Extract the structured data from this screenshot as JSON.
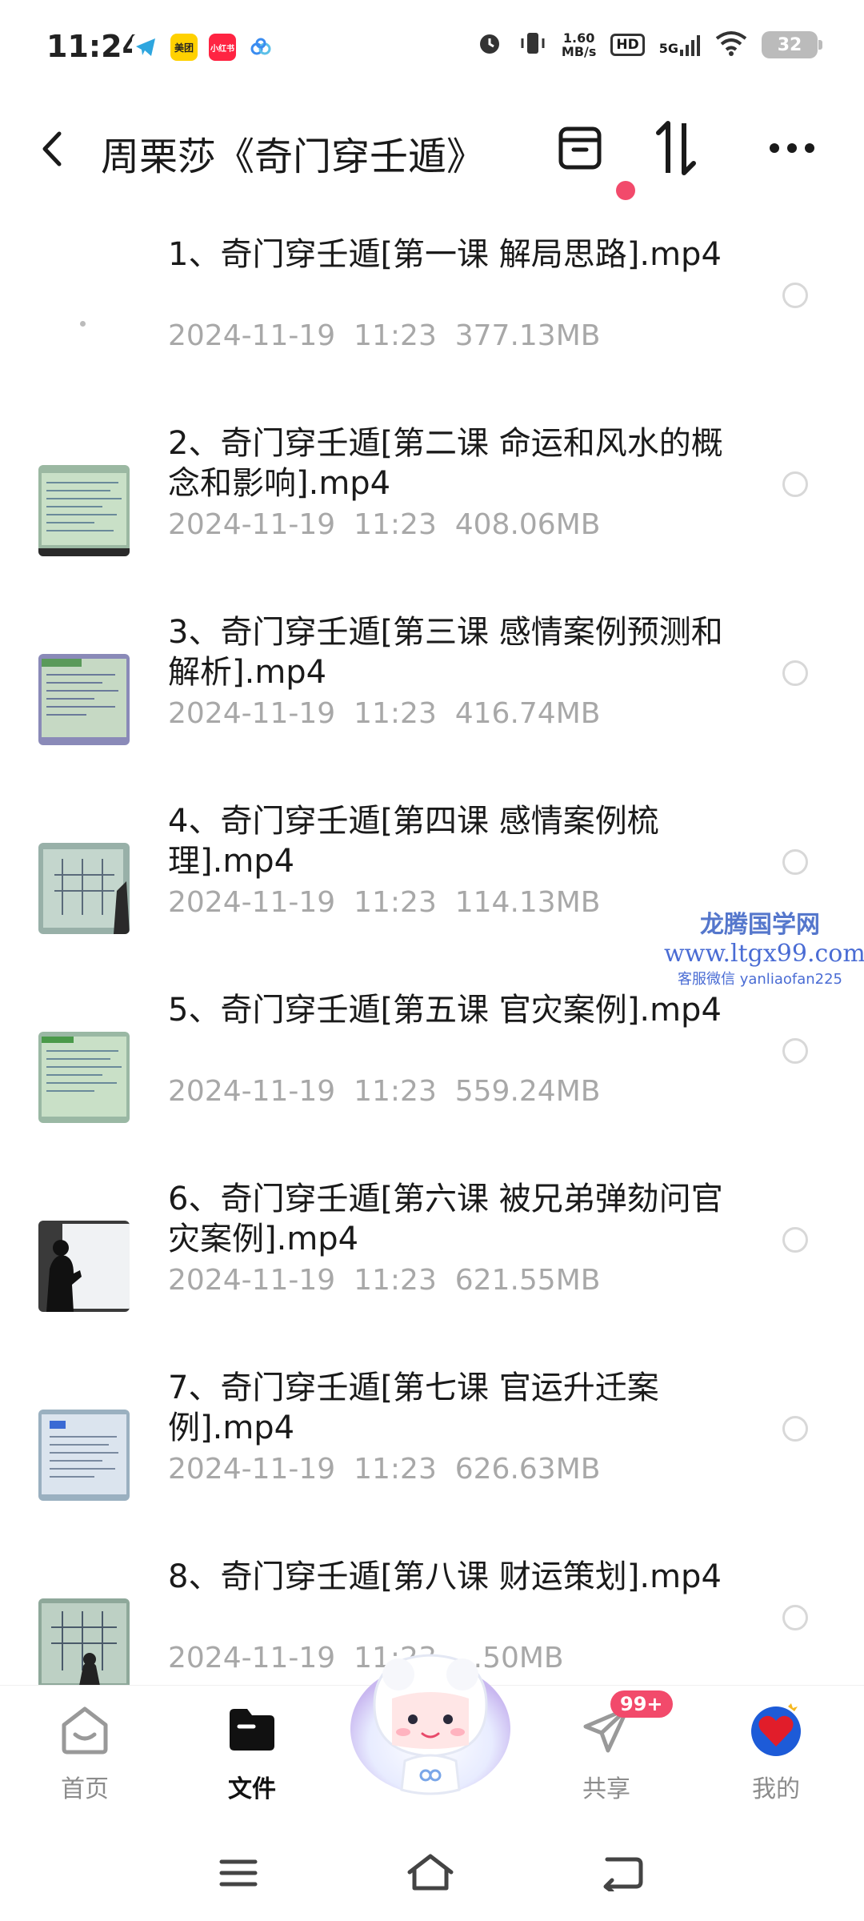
{
  "status_bar": {
    "time": "11:24",
    "app_icons": [
      {
        "name": "telegram-icon",
        "text": "",
        "bg": "#ffffff",
        "fg": "#2ea6df"
      },
      {
        "name": "meituan-icon",
        "text": "美团",
        "bg": "#ffd100",
        "fg": "#222222"
      },
      {
        "name": "xiaohongshu-icon",
        "text": "小红书",
        "bg": "#ff2442",
        "fg": "#ffffff"
      },
      {
        "name": "baidu-netdisk-icon",
        "text": "",
        "bg": "#ffffff",
        "fg": "#3a8cf0"
      }
    ],
    "speed_value": "1.60",
    "speed_unit": "MB/s",
    "hd_label": "HD",
    "network": "5G",
    "battery": "32"
  },
  "header": {
    "title": "周栗莎《奇门穿壬遁》"
  },
  "files": [
    {
      "name": "1、奇门穿壬遁[第一课 解局思路].mp4",
      "meta": "2024-11-19  11:23  377.13MB",
      "thumb": "blank"
    },
    {
      "name": "2、奇门穿壬遁[第二课 命运和风水的概念和影响].mp4",
      "meta": "2024-11-19  11:23  408.06MB",
      "thumb": "slide-green"
    },
    {
      "name": "3、奇门穿壬遁[第三课 感情案例预测和解析].mp4",
      "meta": "2024-11-19  11:23  416.74MB",
      "thumb": "slide-purple"
    },
    {
      "name": "4、奇门穿壬遁[第四课 感情案例梳理].mp4",
      "meta": "2024-11-19  11:23  114.13MB",
      "thumb": "slide-board"
    },
    {
      "name": "5、奇门穿壬遁[第五课 官灾案例].mp4",
      "meta": "2024-11-19  11:23  559.24MB",
      "thumb": "slide-green"
    },
    {
      "name": "6、奇门穿壬遁[第六课 被兄弟弹劾问官灾案例].mp4",
      "meta": "2024-11-19  11:23  621.55MB",
      "thumb": "person-board"
    },
    {
      "name": "7、奇门穿壬遁[第七课 官运升迁案例].mp4",
      "meta": "2024-11-19  11:23  626.63MB",
      "thumb": "slide-blue"
    },
    {
      "name": "8、奇门穿壬遁[第八课 财运策划].mp4",
      "meta": "2024-11-19  11:23  ...50MB",
      "thumb": "slide-board"
    }
  ],
  "watermark": {
    "line1": "龙腾国学网",
    "line2": "www.ltgx99.com",
    "line3": "客服微信 yanliaofan225"
  },
  "bottom_nav": {
    "home": "首页",
    "files": "文件",
    "share": "共享",
    "share_badge": "99+",
    "mine": "我的"
  },
  "colors": {
    "accent_red": "#f24a6b",
    "meta_gray": "#a8a8a8"
  }
}
